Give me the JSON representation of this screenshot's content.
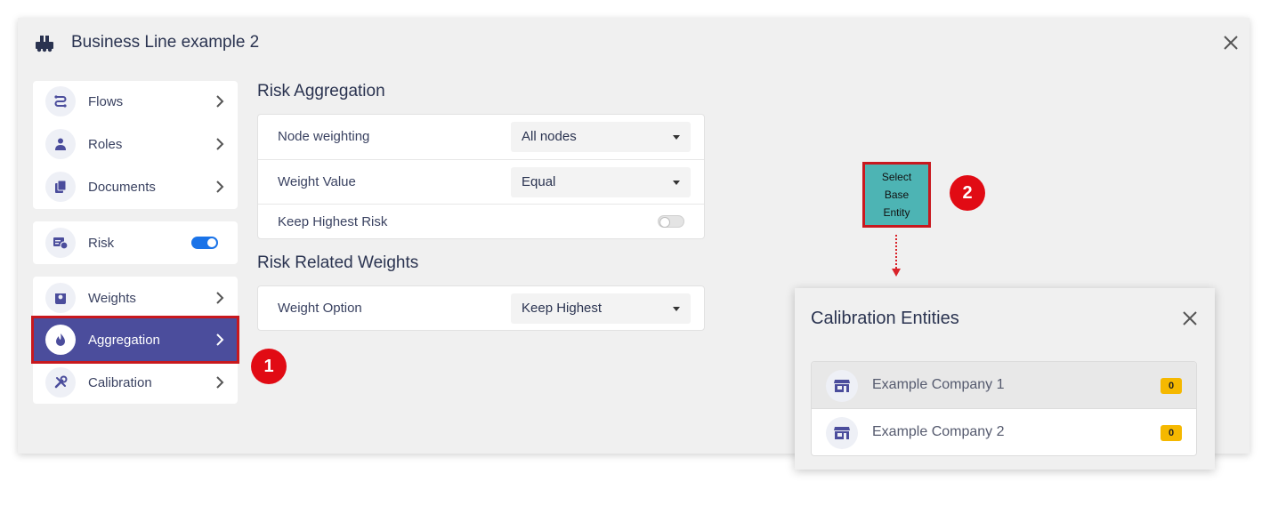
{
  "window": {
    "title": "Business Line example 2"
  },
  "sidebar": {
    "group1": [
      {
        "label": "Flows",
        "icon": "flows-icon"
      },
      {
        "label": "Roles",
        "icon": "roles-icon"
      },
      {
        "label": "Documents",
        "icon": "documents-icon"
      }
    ],
    "group2": [
      {
        "label": "Risk",
        "icon": "risk-icon",
        "toggle_on": true
      }
    ],
    "group3": [
      {
        "label": "Weights",
        "icon": "weights-icon"
      },
      {
        "label": "Aggregation",
        "icon": "aggregation-icon",
        "active": true
      },
      {
        "label": "Calibration",
        "icon": "calibration-icon"
      }
    ]
  },
  "risk_aggregation": {
    "title": "Risk Aggregation",
    "rows": [
      {
        "label": "Node weighting",
        "value": "All nodes"
      },
      {
        "label": "Weight Value",
        "value": "Equal"
      },
      {
        "label": "Keep Highest Risk",
        "switch_on": false
      }
    ]
  },
  "risk_related_weights": {
    "title": "Risk Related Weights",
    "rows": [
      {
        "label": "Weight Option",
        "value": "Keep Highest"
      }
    ]
  },
  "annotations": {
    "step1": "1",
    "step2": "2",
    "callout_lines": [
      "Select",
      "Base",
      "Entity"
    ]
  },
  "calibration_modal": {
    "title": "Calibration Entities",
    "entities": [
      {
        "name": "Example Company 1",
        "count": "0"
      },
      {
        "name": "Example Company 2",
        "count": "0"
      }
    ]
  },
  "colors": {
    "accent": "#4b4d9c",
    "highlight": "#c8181e",
    "step_badge": "#e10b14",
    "callout": "#4db4b4",
    "toggle_on": "#1a73e8",
    "count_badge": "#f5b800"
  }
}
